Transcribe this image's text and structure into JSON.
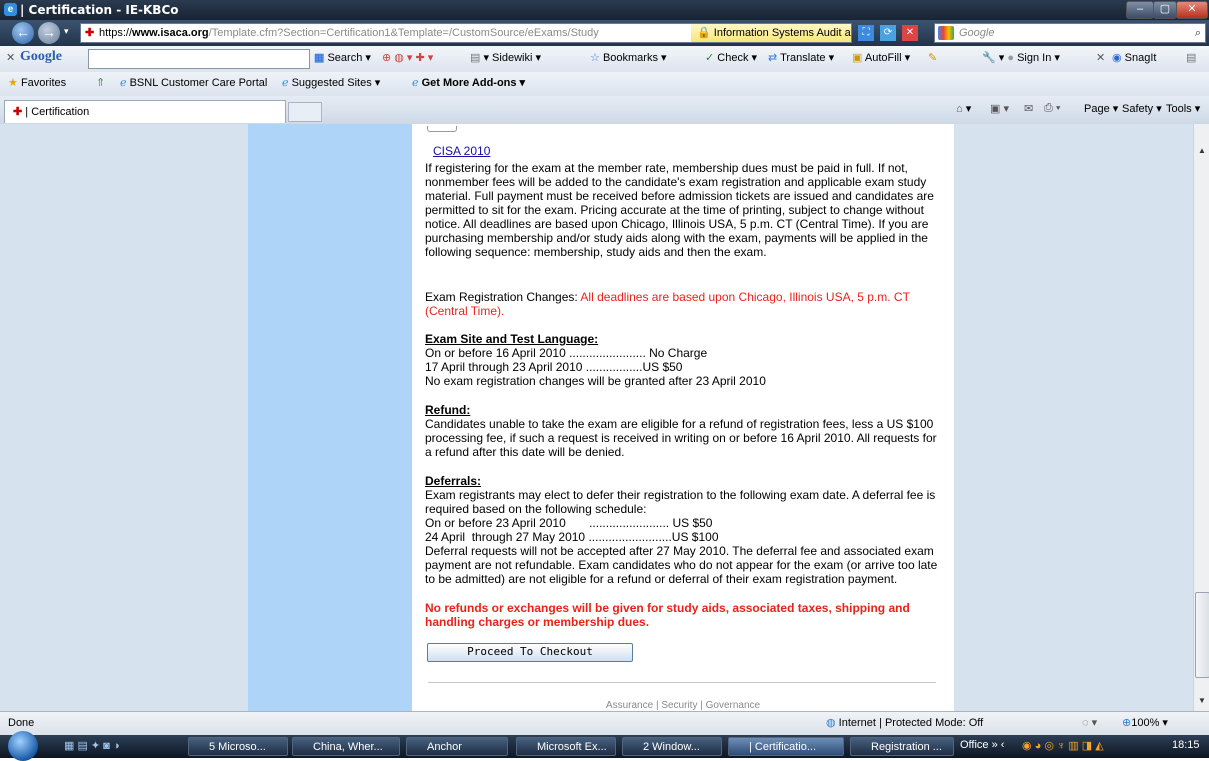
{
  "window": {
    "title": "| Certification - IE-KBCo"
  },
  "address": {
    "scheme": "https://",
    "host": "www.isaca.org",
    "path": "/Template.cfm?Section=Certification1&Template=/CustomSource/eExams/Study",
    "site_identity": "Information Systems Audit and Con...",
    "search_placeholder": "Google"
  },
  "toolbar": {
    "google_label": "Google",
    "items": [
      "Search",
      "Sidewiki",
      "Bookmarks",
      "Check",
      "Translate",
      "AutoFill",
      "Sign In",
      "SnagIt"
    ]
  },
  "favorites": {
    "favorites_label": "Favorites",
    "items": [
      "BSNL Customer Care Portal",
      "Suggested Sites ▾",
      "Get More Add-ons ▾"
    ]
  },
  "tabs": {
    "active": "| Certification"
  },
  "cmdbar": [
    "Page ▾",
    "Safety ▾",
    "Tools ▾"
  ],
  "content": {
    "cisa_link": "CISA 2010",
    "para1": "If registering for the exam at the member rate, membership dues must be paid in full. If not, nonmember fees will be added to the candidate's exam registration and applicable exam study material. Full payment must be received before admission tickets are issued and candidates are permitted to sit for the exam.  Pricing accurate at the time of printing, subject to change without notice.  All deadlines are based upon Chicago, Illinois USA, 5 p.m. CT (Central Time).  If you are purchasing membership and/or study aids along with the exam, payments will be applied in the following sequence: membership, study aids and then the exam.",
    "changes_label": "Exam Registration Changes: ",
    "changes_red": "All deadlines are based upon Chicago, Illinois USA, 5 p.m. CT (Central Time).",
    "site_heading": "Exam Site and Test Language:",
    "site_lines": [
      "On or before 16 April 2010 ....................... No Charge",
      "17 April  through 23 April 2010 .................US $50",
      "No exam registration changes will be granted after 23 April 2010"
    ],
    "refund_heading": "Refund:",
    "refund_text": "Candidates unable to take the exam are eligible for a refund of registration fees, less a US $100 processing fee, if such a request is received in writing on or before 16 April 2010.  All requests for a refund after this date will be denied.",
    "deferral_heading": "Deferrals:",
    "deferral_intro": "Exam registrants may elect to defer their registration to the following exam date.  A deferral fee is required based on the following schedule:",
    "deferral_lines": [
      "On or before 23 April 2010       ........................ US $50",
      "24 April  through 27 May 2010 .........................US $100"
    ],
    "deferral_text": "Deferral requests will not be accepted after 27 May 2010. The deferral fee and associated exam payment are not refundable.  Exam candidates who do not appear for the exam (or arrive too late to be admitted) are not eligible for a refund or deferral of their exam registration payment.",
    "no_refunds": "No refunds or exchanges will be given for study aids, associated taxes, shipping and handling charges or membership dues.",
    "proceed_button": "Proceed To Checkout",
    "footer": "Assurance | Security | Governance"
  },
  "status": {
    "left": "Done",
    "zone": "Internet | Protected Mode: Off",
    "zoom": "100%"
  },
  "taskbar": {
    "items": [
      "5 Microso...",
      "China, Wher...",
      "Anchor",
      "Microsoft Ex...",
      "2 Window...",
      "| Certificatio...",
      "Registration ...",
      "Office"
    ],
    "clock": "18:15"
  },
  "colors": {
    "accent_red": "#e8231a",
    "left_panel": "#aed4f8",
    "link": "#1a0dab"
  }
}
